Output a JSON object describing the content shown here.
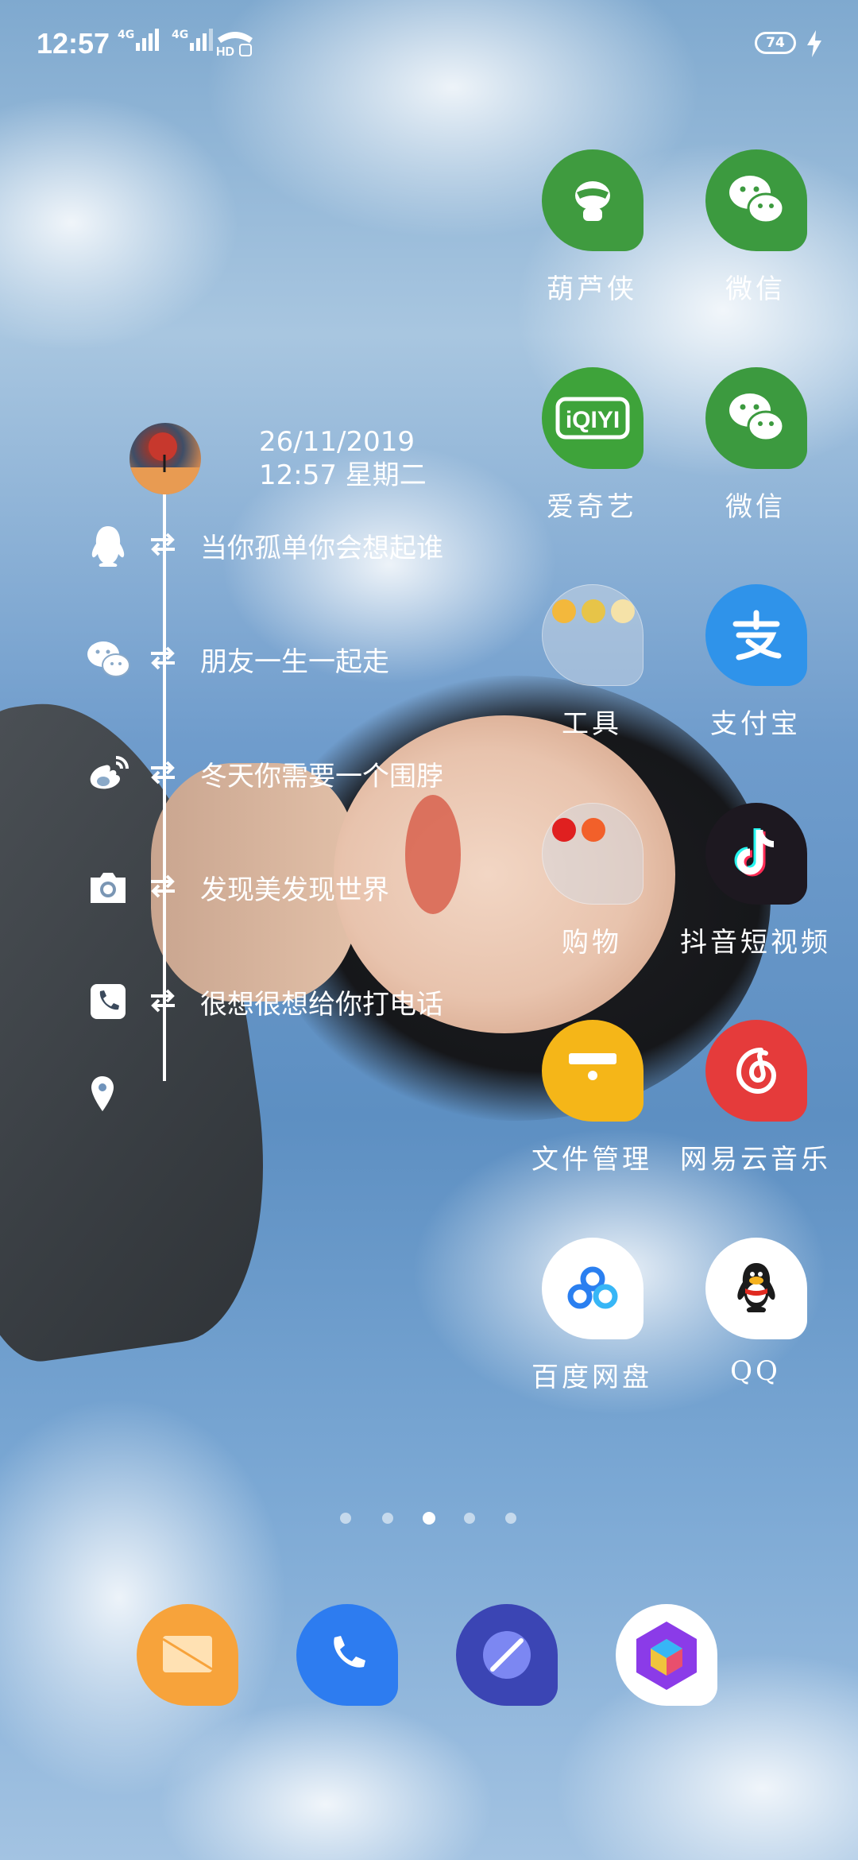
{
  "status_bar": {
    "time": "12:57",
    "net1": "4G",
    "net2": "4G",
    "battery": "74"
  },
  "widget": {
    "date": "26/11/2019",
    "time_day": "12:57 星期二",
    "rows": [
      {
        "icon": "qq-penguin-icon",
        "text": "当你孤单你会想起谁"
      },
      {
        "icon": "wechat-icon",
        "text": "朋友一生一起走"
      },
      {
        "icon": "weibo-icon",
        "text": "冬天你需要一个围脖"
      },
      {
        "icon": "camera-icon",
        "text": "发现美发现世界"
      },
      {
        "icon": "phone-icon",
        "text": "很想很想给你打电话"
      }
    ]
  },
  "apps": [
    {
      "label": "葫芦侠",
      "color": "#3f9b3f"
    },
    {
      "label": "微信",
      "color": "#3c9a3f"
    },
    {
      "label": "爱奇艺",
      "color": "#3ea33a"
    },
    {
      "label": "微信",
      "color": "#3c9a3f"
    },
    {
      "label": "工具",
      "color": "#c9d3dc"
    },
    {
      "label": "支付宝",
      "color": "#2f93ea"
    },
    {
      "label": "购物",
      "color": "#c9d3dc"
    },
    {
      "label": "抖音短视频",
      "color": "#1d1820"
    },
    {
      "label": "文件管理",
      "color": "#f5b618"
    },
    {
      "label": "网易云音乐",
      "color": "#e53b3b"
    },
    {
      "label": "百度网盘",
      "color": "#ffffff"
    },
    {
      "label": "QQ",
      "color": "#ffffff"
    }
  ],
  "page_indicator": {
    "count": 5,
    "active": 3
  },
  "dock": [
    {
      "name": "messages",
      "icon": "message-icon",
      "color": "#f7a33b"
    },
    {
      "name": "phone",
      "icon": "phone-icon",
      "color": "#2d7cf0"
    },
    {
      "name": "browser",
      "icon": "browser-icon",
      "color": "#3b45b4"
    },
    {
      "name": "theme-store",
      "icon": "theme-cube-icon",
      "color": "#ffffff"
    }
  ]
}
